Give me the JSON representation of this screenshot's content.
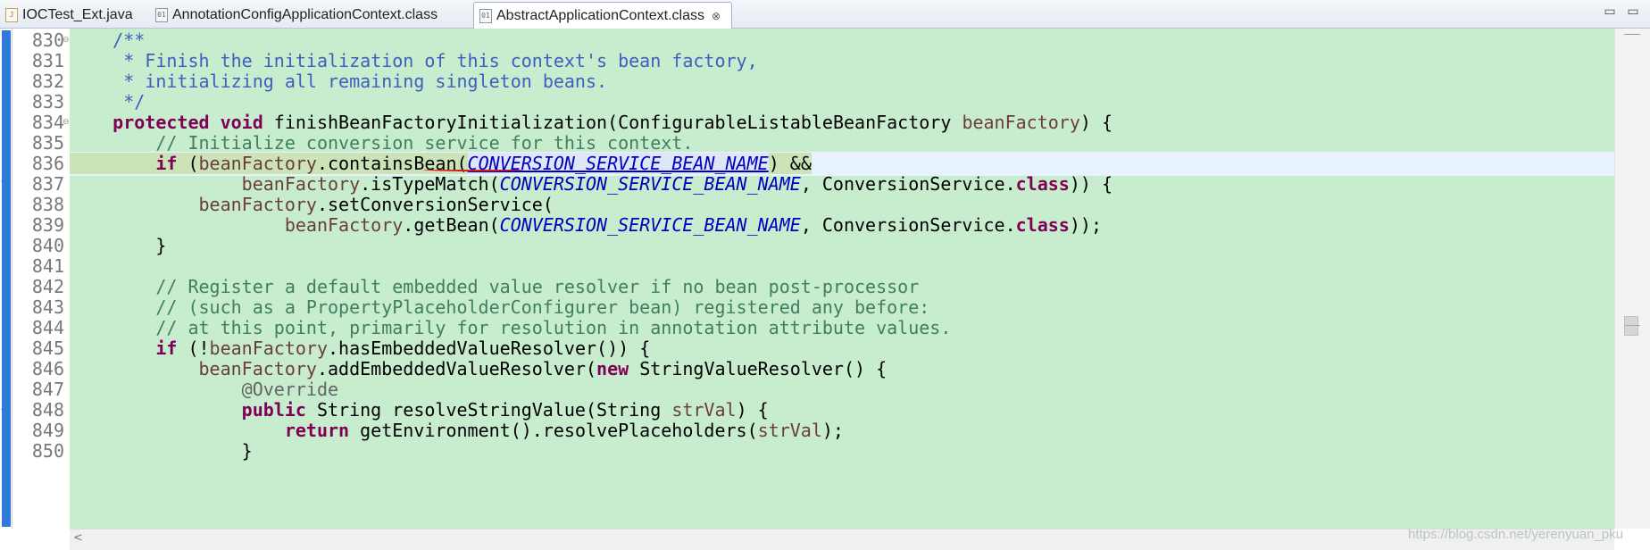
{
  "tabs": [
    {
      "label": "IOCTest_Ext.java",
      "icon": "java-file-icon",
      "active": false
    },
    {
      "label": "AnnotationConfigApplicationContext.class",
      "icon": "class-file-icon",
      "active": false
    },
    {
      "label": "AbstractApplicationContext.class",
      "icon": "class-file-icon",
      "active": true,
      "close": "⊗"
    }
  ],
  "window_controls": {
    "minimize": "▭",
    "maximize": "▭"
  },
  "line_numbers": [
    "830",
    "831",
    "832",
    "833",
    "834",
    "835",
    "836",
    "837",
    "838",
    "839",
    "840",
    "841",
    "842",
    "843",
    "844",
    "845",
    "846",
    "847",
    "848",
    "849",
    "850"
  ],
  "code": {
    "l830": "/**",
    "l831": " * Finish the initialization of this context's bean factory,",
    "l832": " * initializing all remaining singleton beans.",
    "l833": " */",
    "l834_kw1": "protected",
    "l834_kw2": "void",
    "l834_m": " finishBeanFactoryInitialization(ConfigurableListableBeanFactory ",
    "l834_p": "beanFactory",
    "l834_e": ") {",
    "l835": "// Initialize conversion service for this context.",
    "l836_kw": "if",
    "l836_a": " (",
    "l836_p": "beanFactory",
    "l836_b": ".containsBean(",
    "l836_f": "CONVERSION_SERVICE_BEAN_NAME",
    "l836_c": ") &&",
    "l837_p": "beanFactory",
    "l837_a": ".isTypeMatch(",
    "l837_f": "CONVERSION_SERVICE_BEAN_NAME",
    "l837_b": ", ConversionService.",
    "l837_kw": "class",
    "l837_c": ")) {",
    "l838_p": "beanFactory",
    "l838_a": ".setConversionService(",
    "l839_p": "beanFactory",
    "l839_a": ".getBean(",
    "l839_f": "CONVERSION_SERVICE_BEAN_NAME",
    "l839_b": ", ConversionService.",
    "l839_kw": "class",
    "l839_c": "));",
    "l840": "}",
    "l842": "// Register a default embedded value resolver if no bean post-processor",
    "l843": "// (such as a PropertyPlaceholderConfigurer bean) registered any before:",
    "l844": "// at this point, primarily for resolution in annotation attribute values.",
    "l845_kw": "if",
    "l845_a": " (!",
    "l845_p": "beanFactory",
    "l845_b": ".hasEmbeddedValueResolver()) {",
    "l846_p": "beanFactory",
    "l846_a": ".addEmbeddedValueResolver(",
    "l846_kw": "new",
    "l846_b": " StringValueResolver() {",
    "l847": "@Override",
    "l848_kw": "public",
    "l848_a": " String resolveStringValue(String ",
    "l848_p": "strVal",
    "l848_b": ") {",
    "l849_kw": "return",
    "l849_a": " getEnvironment().resolvePlaceholders(",
    "l849_p": "strVal",
    "l849_b": ");",
    "l850": "}"
  },
  "watermark": "https://blog.csdn.net/yerenyuan_pku",
  "colors": {
    "editor_bg": "#c7ecce",
    "keyword": "#7f0055",
    "comment": "#3f7f5f",
    "javadoc": "#3f5fbf",
    "field": "#0000c0",
    "current_line": "#e8f2fe"
  }
}
